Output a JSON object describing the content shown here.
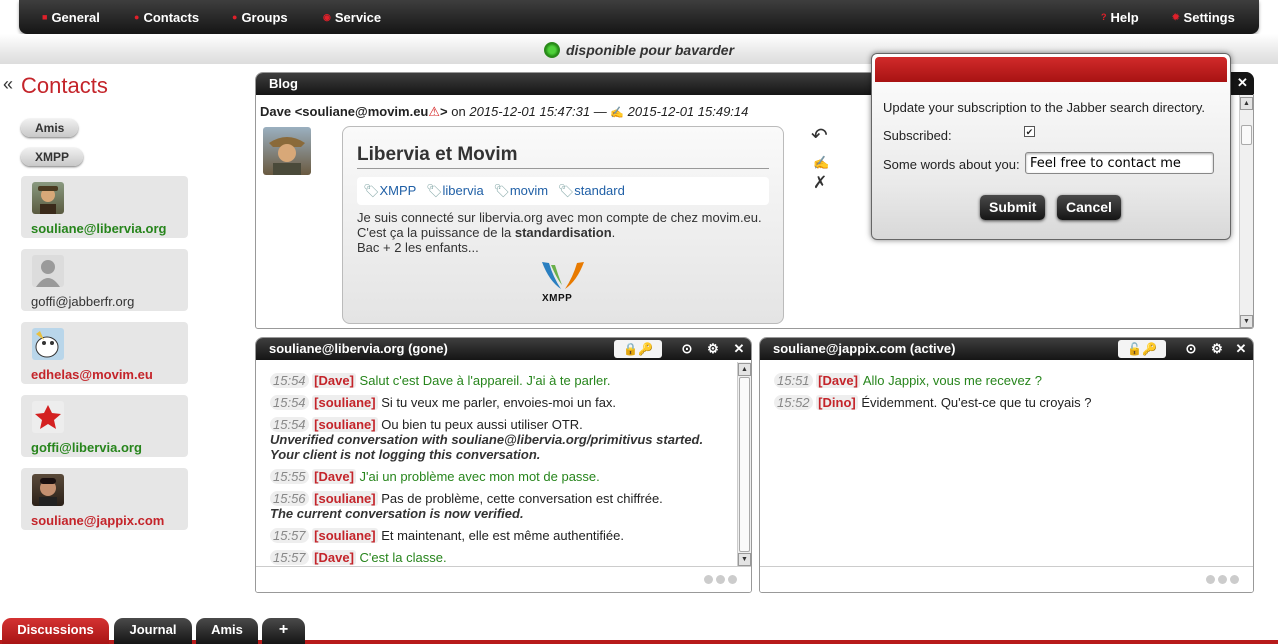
{
  "menu": {
    "general": "General",
    "contacts": "Contacts",
    "groups": "Groups",
    "service": "Service",
    "help": "Help",
    "settings": "Settings",
    "help_icon": "?",
    "square_icon": "■"
  },
  "status": {
    "text": "disponible pour bavarder",
    "color": "#2b9a1b"
  },
  "contacts_panel": {
    "collapse": "«",
    "title": "Contacts",
    "groups": [
      "Amis",
      "XMPP"
    ],
    "items": [
      {
        "jid": "souliane@libervia.org",
        "color": "#27851c"
      },
      {
        "jid": "goffi@jabberfr.org",
        "color": "#333333"
      },
      {
        "jid": "edhelas@movim.eu",
        "color": "#c4242a"
      },
      {
        "jid": "goffi@libervia.org",
        "color": "#27851c"
      },
      {
        "jid": "souliane@jappix.com",
        "color": "#c4242a"
      }
    ]
  },
  "blog": {
    "title": "Blog",
    "close": "✕",
    "author": "Dave <souliane@movim.eu",
    "warning": "⚠",
    "author_end": ">",
    "on": "on",
    "created": "2015-12-01 15:47:31",
    "dash": "—",
    "edited_icon": "✍",
    "updated": "2015-12-01 15:49:14",
    "entry_title": "Libervia et Movim",
    "tags": [
      "XMPP",
      "libervia",
      "movim",
      "standard"
    ],
    "tag_icon": "🏷",
    "body_line1": "Je suis connecté sur libervia.org avec mon compte de chez movim.eu.",
    "body_line2_pre": "C'est ça la puissance de la",
    "body_line2_bold": "standardisation",
    "body_line2_post": ".",
    "body_line3": "Bac + 2 les enfants...",
    "logo_text": "XMPP",
    "actions": {
      "reply": "↶",
      "edit": "✍",
      "delete": "✗"
    }
  },
  "chat_left": {
    "title": "souliane@libervia.org (gone)",
    "lock_icons": "🔒🔑",
    "buttons": {
      "menu": "⊙",
      "settings": "⚙",
      "close": "✕"
    },
    "messages": [
      {
        "time": "15:54",
        "nick": "[Dave]",
        "text": "Salut c'est Dave à l'appareil. J'ai à te parler."
      },
      {
        "time": "15:54",
        "nick": "[souliane]",
        "text": "Si tu veux me parler, envoies-moi un fax."
      },
      {
        "time": "15:54",
        "nick": "[souliane]",
        "text": "Ou bien tu peux aussi utiliser OTR."
      },
      {
        "time": "15:55",
        "nick": "[Dave]",
        "text": "J'ai un problème avec mon mot de passe."
      },
      {
        "time": "15:56",
        "nick": "[souliane]",
        "text": "Pas de problème, cette conversation est chiffrée."
      },
      {
        "time": "15:57",
        "nick": "[souliane]",
        "text": "Et maintenant, elle est même authentifiée."
      },
      {
        "time": "15:57",
        "nick": "[Dave]",
        "text": "C'est la classe."
      }
    ],
    "system": [
      "Unverified conversation with souliane@libervia.org/primitivus started.",
      "Your client is not logging this conversation.",
      "The current conversation is now verified."
    ]
  },
  "chat_right": {
    "title": "souliane@jappix.com (active)",
    "lock_icons": "🔓🔑",
    "buttons": {
      "menu": "⊙",
      "settings": "⚙",
      "close": "✕"
    },
    "messages": [
      {
        "time": "15:51",
        "nick": "[Dave]",
        "text": "Allo Jappix, vous me recevez ?"
      },
      {
        "time": "15:52",
        "nick": "[Dino]",
        "text": "Évidemment. Qu'est-ce que tu croyais ?"
      }
    ]
  },
  "dialog": {
    "description": "Update your subscription to the Jabber search directory.",
    "subscribed_label": "Subscribed:",
    "subscribed_check": "✔",
    "about_label": "Some words about you:",
    "about_value": "Feel free to contact me",
    "submit": "Submit",
    "cancel": "Cancel"
  },
  "tabs": {
    "discussions": "Discussions",
    "journal": "Journal",
    "amis": "Amis",
    "add": "+"
  },
  "colors": {
    "accent": "#c4242a",
    "dark": "#1e1e1e",
    "green": "#27851c"
  }
}
